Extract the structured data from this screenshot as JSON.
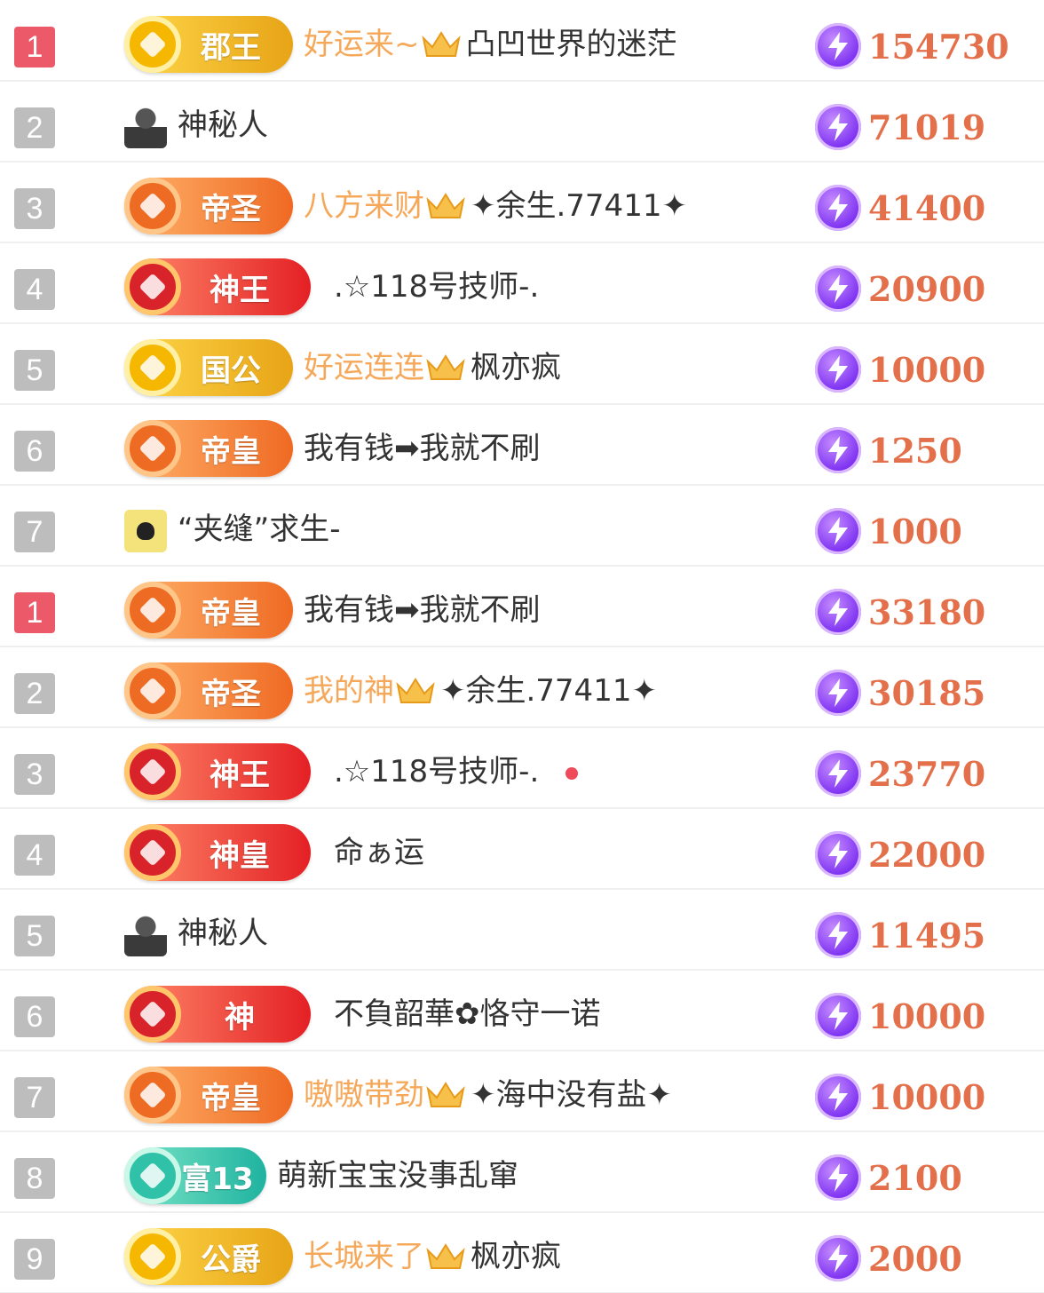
{
  "rows": [
    {
      "rank": "1",
      "top": true,
      "badge": {
        "label": "郡王",
        "style": "gold"
      },
      "prefix": "好运来~",
      "crown": true,
      "name": "凸凹世界的迷茫",
      "amount": "154730"
    },
    {
      "rank": "2",
      "top": false,
      "avatar": "mystery-avatar-icon",
      "name": "神秘人",
      "amount": "71019"
    },
    {
      "rank": "3",
      "top": false,
      "badge": {
        "label": "帝圣",
        "style": "orange"
      },
      "prefix": "八方来财",
      "crown": true,
      "name": "✦余生.77411✦",
      "amount": "41400"
    },
    {
      "rank": "4",
      "top": false,
      "badge": {
        "label": "神王",
        "style": "red"
      },
      "name": ".☆118号技师-.",
      "amount": "20900"
    },
    {
      "rank": "5",
      "top": false,
      "badge": {
        "label": "国公",
        "style": "gold"
      },
      "prefix": "好运连连",
      "crown": true,
      "name": "枫亦疯",
      "amount": "10000"
    },
    {
      "rank": "6",
      "top": false,
      "badge": {
        "label": "帝皇",
        "style": "orange"
      },
      "name": "我有钱➡我就不刷",
      "amount": "1250"
    },
    {
      "rank": "7",
      "top": false,
      "avatar": "beetle-avatar-icon",
      "name": "“夹缝”求生-",
      "amount": "1000"
    },
    {
      "rank": "1",
      "top": true,
      "badge": {
        "label": "帝皇",
        "style": "orange"
      },
      "name": "我有钱➡我就不刷",
      "amount": "33180"
    },
    {
      "rank": "2",
      "top": false,
      "badge": {
        "label": "帝圣",
        "style": "orange"
      },
      "prefix": "我的神",
      "crown": true,
      "name": "✦余生.77411✦",
      "amount": "30185"
    },
    {
      "rank": "3",
      "top": false,
      "badge": {
        "label": "神王",
        "style": "red"
      },
      "name": ".☆118号技师-.",
      "dot": true,
      "amount": "23770"
    },
    {
      "rank": "4",
      "top": false,
      "badge": {
        "label": "神皇",
        "style": "red"
      },
      "name": "命ぁ运",
      "amount": "22000"
    },
    {
      "rank": "5",
      "top": false,
      "avatar": "mystery-avatar-icon",
      "name": "神秘人",
      "amount": "11495"
    },
    {
      "rank": "6",
      "top": false,
      "badge": {
        "label": "神",
        "style": "red"
      },
      "name": "不負韶華✿恪守一诺",
      "amount": "10000"
    },
    {
      "rank": "7",
      "top": false,
      "badge": {
        "label": "帝皇",
        "style": "orange"
      },
      "prefix": "嗷嗷带劲",
      "crown": true,
      "name": "✦海中没有盐✦",
      "amount": "10000"
    },
    {
      "rank": "8",
      "top": false,
      "badge": {
        "label": "富13",
        "style": "teal"
      },
      "name": "萌新宝宝没事乱窜",
      "amount": "2100"
    },
    {
      "rank": "9",
      "top": false,
      "badge": {
        "label": "公爵",
        "style": "gold"
      },
      "prefix": "长城来了",
      "crown": true,
      "name": "枫亦疯",
      "amount": "2000"
    }
  ],
  "colors": {
    "rank_top": "#ec5a6a",
    "rank_default": "#bdbdbd",
    "amount": "#e3704a",
    "prefix": "#f6a85a"
  },
  "icons": {
    "coin": "lightning-coin-icon",
    "crown": "crown-icon"
  }
}
